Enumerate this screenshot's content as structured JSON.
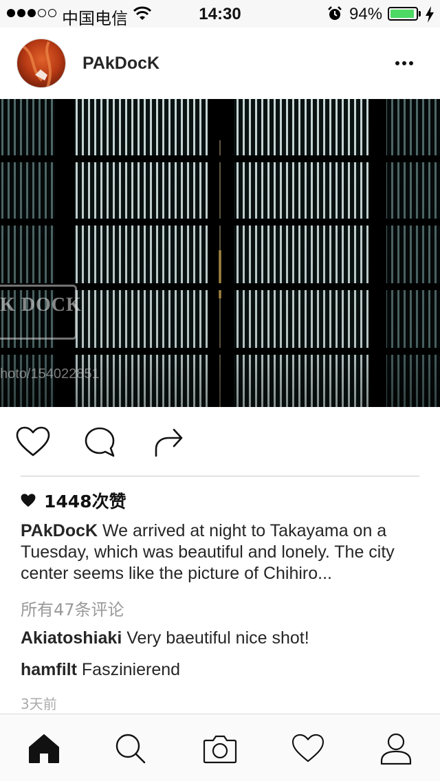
{
  "status_bar": {
    "carrier": "中国电信",
    "time": "14:30",
    "battery_percent": "94%",
    "battery_level": 0.94,
    "signal_bars": 3,
    "signal_total": 5,
    "battery_color": "#4cd964"
  },
  "post": {
    "username": "PAkDocK",
    "watermark_text": "K DOCK",
    "watermark_url": "hoto/154022851",
    "likes": "1448次赞",
    "caption_user": "PAkDocK",
    "caption_text": "We arrived at night to Takayama on a Tuesday, which was beautiful and lonely. The city center seems like the picture of Chihiro...",
    "view_comments": "所有47条评论",
    "comments": [
      {
        "user": "Akiatoshiaki",
        "text": "Very baeutiful nice shot!"
      },
      {
        "user": "hamfilt",
        "text": "Faszinierend"
      }
    ],
    "timestamp": "3天前"
  },
  "icons": {
    "header": [
      "avatar",
      "more-icon"
    ],
    "actions": [
      "heart-icon",
      "comment-icon",
      "share-icon"
    ],
    "tabs": [
      "home-icon",
      "search-icon",
      "camera-icon",
      "activity-heart-icon",
      "profile-icon"
    ]
  }
}
